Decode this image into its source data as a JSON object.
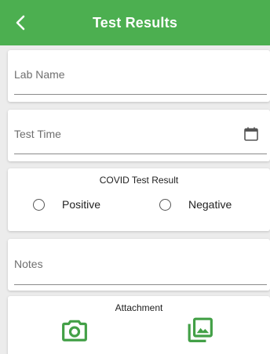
{
  "header": {
    "title": "Test Results",
    "back_icon": "chevron-left-icon"
  },
  "lab": {
    "placeholder": "Lab Name"
  },
  "time": {
    "placeholder": "Test Time",
    "icon": "calendar-icon"
  },
  "result": {
    "title": "COVID Test Result",
    "options": [
      {
        "label": "Positive",
        "selected": false
      },
      {
        "label": "Negative",
        "selected": false
      }
    ]
  },
  "notes": {
    "placeholder": "Notes"
  },
  "attachment": {
    "title": "Attachment",
    "camera_icon": "camera-icon",
    "gallery_icon": "gallery-icon"
  },
  "colors": {
    "accent": "#4caf50",
    "icon_green": "#43a047"
  }
}
